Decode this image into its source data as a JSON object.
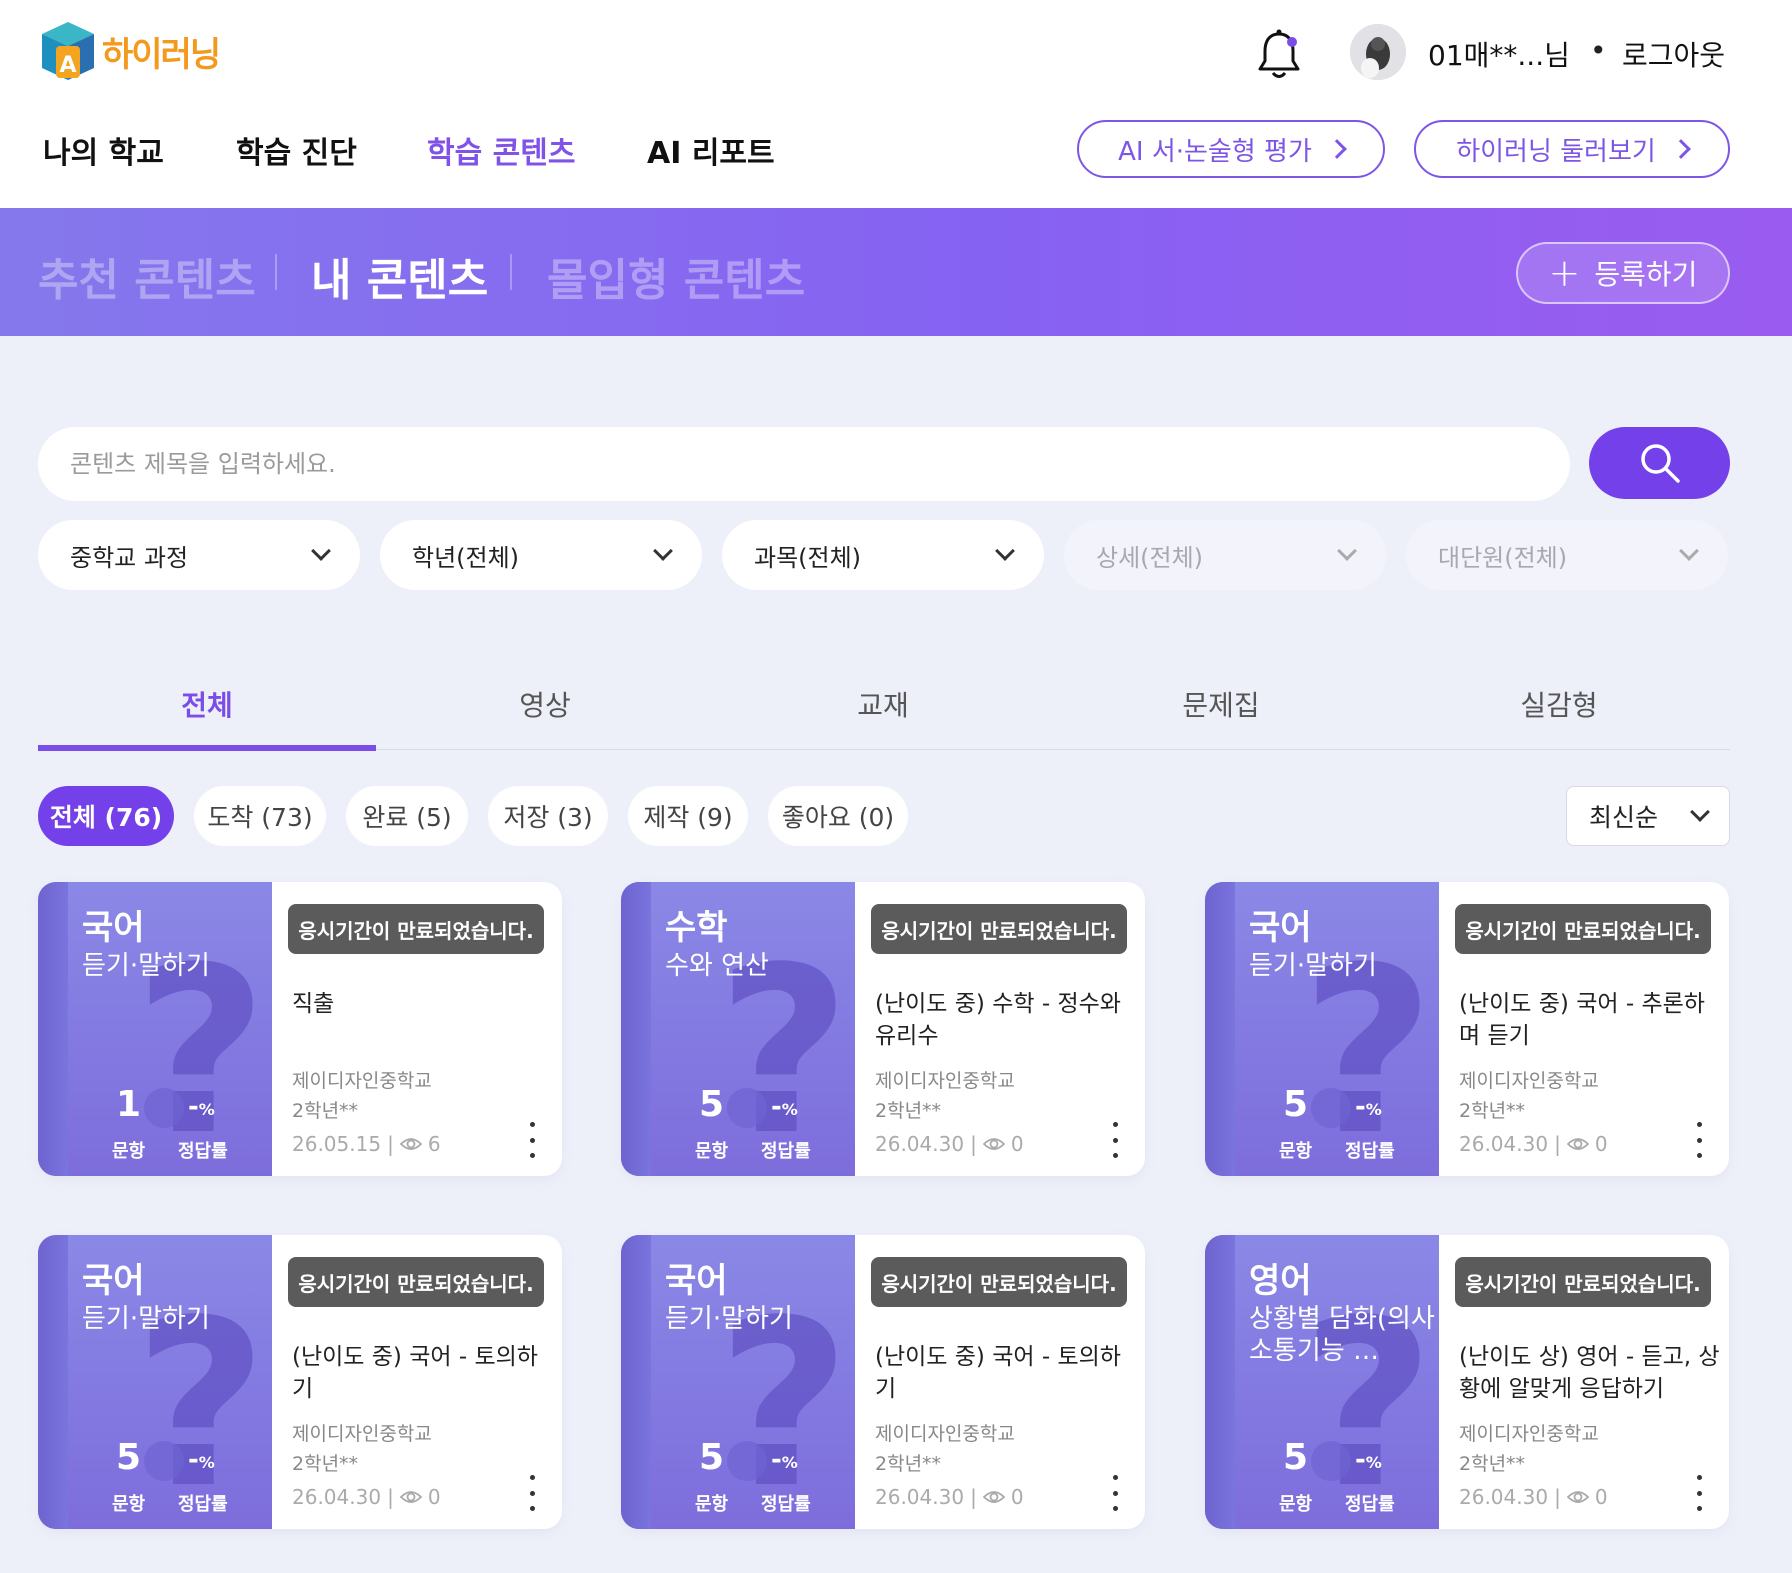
{
  "header": {
    "logo_text": "하이러닝",
    "user_name": "01매**...님",
    "separator": "•",
    "logout_label": "로그아웃"
  },
  "nav": {
    "items": [
      {
        "label": "나의 학교",
        "active": false
      },
      {
        "label": "학습 진단",
        "active": false
      },
      {
        "label": "학습 콘텐츠",
        "active": true
      },
      {
        "label": "AI 리포트",
        "active": false
      }
    ],
    "ai_eval_label": "AI 서·논술형 평가",
    "tour_label": "하이러닝 둘러보기"
  },
  "banner": {
    "tabs": [
      {
        "label": "추천 콘텐츠",
        "active": false
      },
      {
        "label": "내 콘텐츠",
        "active": true
      },
      {
        "label": "몰입형 콘텐츠",
        "active": false
      }
    ],
    "register_label": "등록하기"
  },
  "search": {
    "placeholder": "콘텐츠 제목을 입력하세요.",
    "value": ""
  },
  "filters": [
    {
      "label": "중학교 과정",
      "enabled": true
    },
    {
      "label": "학년(전체)",
      "enabled": true
    },
    {
      "label": "과목(전체)",
      "enabled": true
    },
    {
      "label": "상세(전체)",
      "enabled": false
    },
    {
      "label": "대단원(전체)",
      "enabled": false
    }
  ],
  "type_tabs": [
    {
      "label": "전체",
      "active": true
    },
    {
      "label": "영상",
      "active": false
    },
    {
      "label": "교재",
      "active": false
    },
    {
      "label": "문제집",
      "active": false
    },
    {
      "label": "실감형",
      "active": false
    }
  ],
  "chips": [
    {
      "label": "전체 (76)",
      "active": true
    },
    {
      "label": "도착 (73)",
      "active": false
    },
    {
      "label": "완료 (5)",
      "active": false
    },
    {
      "label": "저장 (3)",
      "active": false
    },
    {
      "label": "제작 (9)",
      "active": false
    },
    {
      "label": "좋아요 (0)",
      "active": false
    }
  ],
  "sort": {
    "label": "최신순"
  },
  "card_labels": {
    "questions": "문항",
    "correct_rate": "정답률",
    "rate_value": "-",
    "rate_unit": "%"
  },
  "cards": [
    {
      "subject": "국어",
      "area": "듣기·말하기",
      "count": "1",
      "status": "응시기간이 만료되었습니다.",
      "title": "직출",
      "school": "제이디자인중학교",
      "grade": "2학년**",
      "date": "26.05.15",
      "views": "6"
    },
    {
      "subject": "수학",
      "area": "수와 연산",
      "count": "5",
      "status": "응시기간이 만료되었습니다.",
      "title": "(난이도 중) 수학 - 정수와 유리수",
      "school": "제이디자인중학교",
      "grade": "2학년**",
      "date": "26.04.30",
      "views": "0"
    },
    {
      "subject": "국어",
      "area": "듣기·말하기",
      "count": "5",
      "status": "응시기간이 만료되었습니다.",
      "title": "(난이도 중) 국어 - 추론하며 듣기",
      "school": "제이디자인중학교",
      "grade": "2학년**",
      "date": "26.04.30",
      "views": "0"
    },
    {
      "subject": "국어",
      "area": "듣기·말하기",
      "count": "5",
      "status": "응시기간이 만료되었습니다.",
      "title": "(난이도 중) 국어 - 토의하기",
      "school": "제이디자인중학교",
      "grade": "2학년**",
      "date": "26.04.30",
      "views": "0"
    },
    {
      "subject": "국어",
      "area": "듣기·말하기",
      "count": "5",
      "status": "응시기간이 만료되었습니다.",
      "title": "(난이도 중) 국어 - 토의하기",
      "school": "제이디자인중학교",
      "grade": "2학년**",
      "date": "26.04.30",
      "views": "0"
    },
    {
      "subject": "영어",
      "area": "상황별 담화(의사소통기능 …",
      "count": "5",
      "status": "응시기간이 만료되었습니다.",
      "title": "(난이도 상) 영어 - 듣고, 상황에 알맞게 응답하기",
      "school": "제이디자인중학교",
      "grade": "2학년**",
      "date": "26.04.30",
      "views": "0"
    }
  ],
  "colors": {
    "accent": "#7440ea",
    "active_text": "#8052e8",
    "banner_start": "#8578ec",
    "banner_end": "#9a5bf0",
    "background": "#eef0f9",
    "expired_badge": "#5b5b5b"
  },
  "icons": {
    "bell": "bell-icon",
    "search": "search-icon",
    "chevron": "chevron-down-icon",
    "eye": "eye-icon",
    "more": "more-vertical-icon"
  }
}
